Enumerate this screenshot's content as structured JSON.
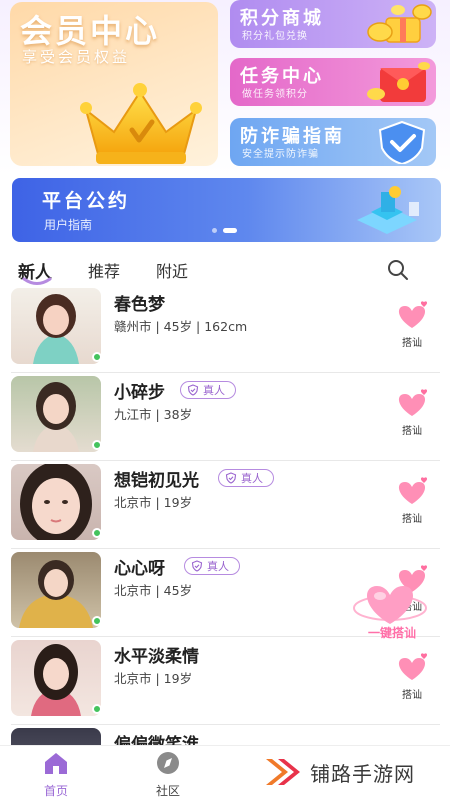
{
  "member": {
    "title": "会员中心",
    "subtitle": "享受会员权益"
  },
  "cards": [
    {
      "title": "积分商城",
      "subtitle": "积分礼包兑换"
    },
    {
      "title": "任务中心",
      "subtitle": "做任务领积分"
    },
    {
      "title": "防诈骗指南",
      "subtitle": "安全提示防诈骗"
    }
  ],
  "banner": {
    "title": "平台公约",
    "subtitle": "用户指南"
  },
  "tabs": [
    "新人",
    "推荐",
    "附近"
  ],
  "users": [
    {
      "name": "春色梦",
      "info": "赣州市 | 45岁 | 162cm",
      "verified": false
    },
    {
      "name": "小碎步",
      "info": "九江市 | 38岁",
      "verified": true
    },
    {
      "name": "想铠初见光",
      "info": "北京市 | 19岁",
      "verified": true
    },
    {
      "name": "心心呀",
      "info": "北京市 | 45岁",
      "verified": true
    },
    {
      "name": "水平淡柔情",
      "info": "北京市 | 19岁",
      "verified": false
    },
    {
      "name": "偏偏微笑淮",
      "info": "",
      "verified": false
    }
  ],
  "verified_label": "真人",
  "chat_label": "搭讪",
  "one_key_label": "一键搭讪",
  "nav": [
    {
      "label": "首页",
      "active": true
    },
    {
      "label": "社区",
      "active": false
    }
  ],
  "watermark": "铺路手游网",
  "colors": {
    "accent": "#9b6ad6",
    "heart": "#ff8fb6",
    "banner": "#4a6fe9"
  }
}
